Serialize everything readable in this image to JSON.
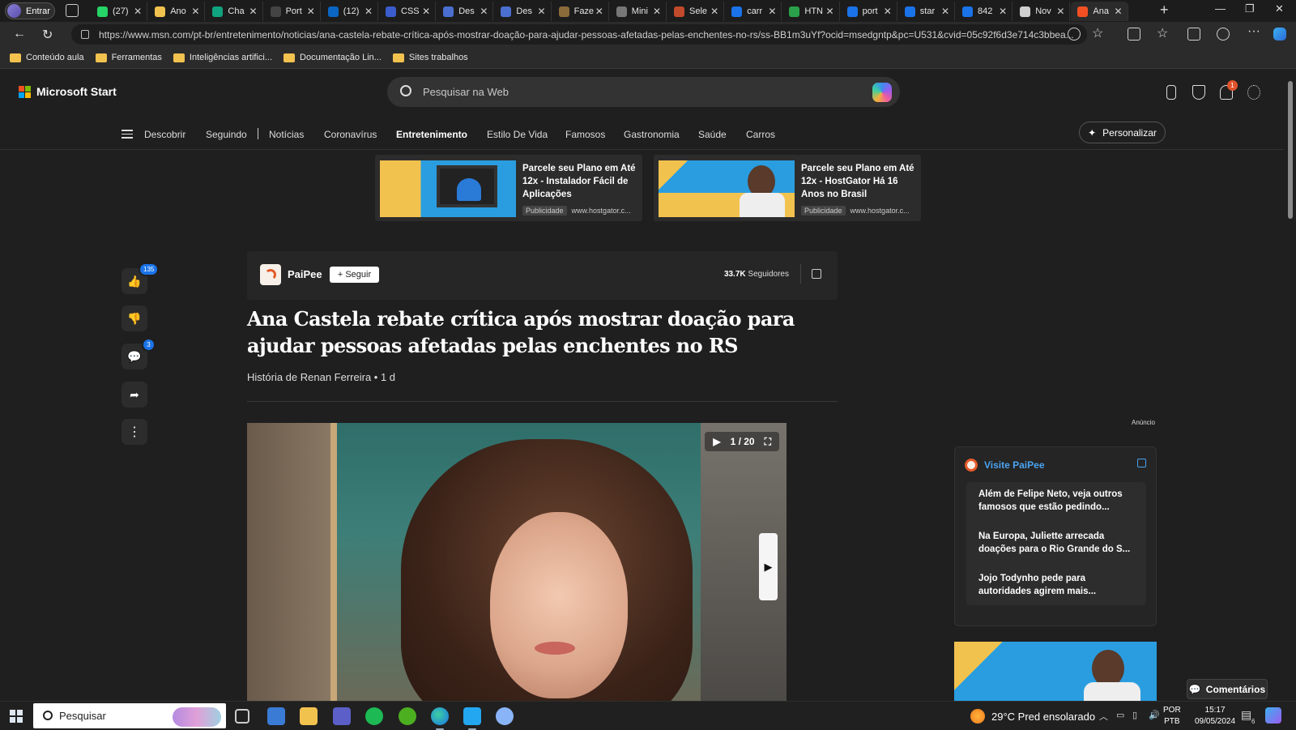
{
  "browser": {
    "profile_label": "Entrar",
    "tabs": [
      {
        "label": "(27)",
        "favicon_color": "#25d366",
        "icon": "whatsapp-icon"
      },
      {
        "label": "Ano",
        "favicon_color": "#f2c24f",
        "icon": "pencil-icon"
      },
      {
        "label": "Cha",
        "favicon_color": "#10a37f",
        "icon": "chatgpt-icon"
      },
      {
        "label": "Port",
        "favicon_color": "#444444",
        "icon": "arrow-icon"
      },
      {
        "label": "(12)",
        "favicon_color": "#0a66c2",
        "icon": "linkedin-icon"
      },
      {
        "label": "CSS",
        "favicon_color": "#3a5ccc",
        "icon": "css-icon"
      },
      {
        "label": "Des",
        "favicon_color": "#4a6fd0",
        "icon": "edge-icon"
      },
      {
        "label": "Des",
        "favicon_color": "#4a6fd0",
        "icon": "edge-icon"
      },
      {
        "label": "Faze",
        "favicon_color": "#8b6b3a",
        "icon": "image-icon"
      },
      {
        "label": "Mini",
        "favicon_color": "#777777",
        "icon": "circle-icon"
      },
      {
        "label": "Sele",
        "favicon_color": "#c04a2a",
        "icon": "tool-icon"
      },
      {
        "label": "carr",
        "favicon_color": "#1a73e8",
        "icon": "search-icon"
      },
      {
        "label": "HTN",
        "favicon_color": "#2aa04a",
        "icon": "w3-icon"
      },
      {
        "label": "port",
        "favicon_color": "#1a73e8",
        "icon": "search-icon"
      },
      {
        "label": "star",
        "favicon_color": "#1a73e8",
        "icon": "search-icon"
      },
      {
        "label": "842",
        "favicon_color": "#1a73e8",
        "icon": "search-icon"
      },
      {
        "label": "Nov",
        "favicon_color": "#cfcfcf",
        "icon": "page-icon"
      },
      {
        "label": "Ana",
        "favicon_color": "#f25022",
        "icon": "msn-icon",
        "active": true
      }
    ],
    "url": "https://www.msn.com/pt-br/entretenimento/noticias/ana-castela-rebate-crítica-após-mostrar-doação-para-ajudar-pessoas-afetadas-pelas-enchentes-no-rs/ss-BB1m3uYf?ocid=msedgntp&pc=U531&cvid=05c92f6d3e714c3bbea...",
    "bookmarks": [
      "Conteúdo aula",
      "Ferramentas",
      "Inteligências artifici...",
      "Documentação Lin...",
      "Sites trabalhos"
    ]
  },
  "msn": {
    "logo_text": "Microsoft Start",
    "search_placeholder": "Pesquisar na Web",
    "notification_count": "1",
    "nav": [
      "Descobrir",
      "Seguindo",
      "Notícias",
      "Coronavírus",
      "Entretenimento",
      "Estilo De Vida",
      "Famosos",
      "Gastronomia",
      "Saúde",
      "Carros"
    ],
    "nav_active": "Entretenimento",
    "personalize_label": "Personalizar",
    "ads": [
      {
        "title": "Parcele seu Plano em Até 12x - Instalador Fácil de Aplicações",
        "tag": "Publicidade",
        "domain": "www.hostgator.c..."
      },
      {
        "title": "Parcele seu Plano em Até 12x - HostGator Há 16 Anos no Brasil",
        "tag": "Publicidade",
        "domain": "www.hostgator.c..."
      }
    ],
    "rail": {
      "likes": "135",
      "comments": "3"
    },
    "source": {
      "name": "PaiPee",
      "follow_label": "+ Seguir",
      "followers_count": "33.7K",
      "followers_label": "Seguidores"
    },
    "article": {
      "title": "Ana Castela rebate crítica após mostrar doação para ajudar pessoas afetadas pelas enchentes no RS",
      "byline": "História de Renan Ferreira • 1 d"
    },
    "gallery": {
      "counter": "1 / 20"
    },
    "sidebar": {
      "ad_label": "Anúncio",
      "visit_title": "Visite PaiPee",
      "items": [
        "Além de Felipe Neto, veja outros famosos que estão pedindo...",
        "Na Europa, Juliette arrecada doações para o Rio Grande do S...",
        "Jojo Todynho pede para autoridades agirem mais..."
      ]
    },
    "comments_button": "Comentários"
  },
  "taskbar": {
    "search_placeholder": "Pesquisar",
    "weather": "29°C  Pred ensolarado",
    "lang_line1": "POR",
    "lang_line2": "PTB",
    "time": "15:17",
    "date": "09/05/2024",
    "notification_count": "6"
  }
}
